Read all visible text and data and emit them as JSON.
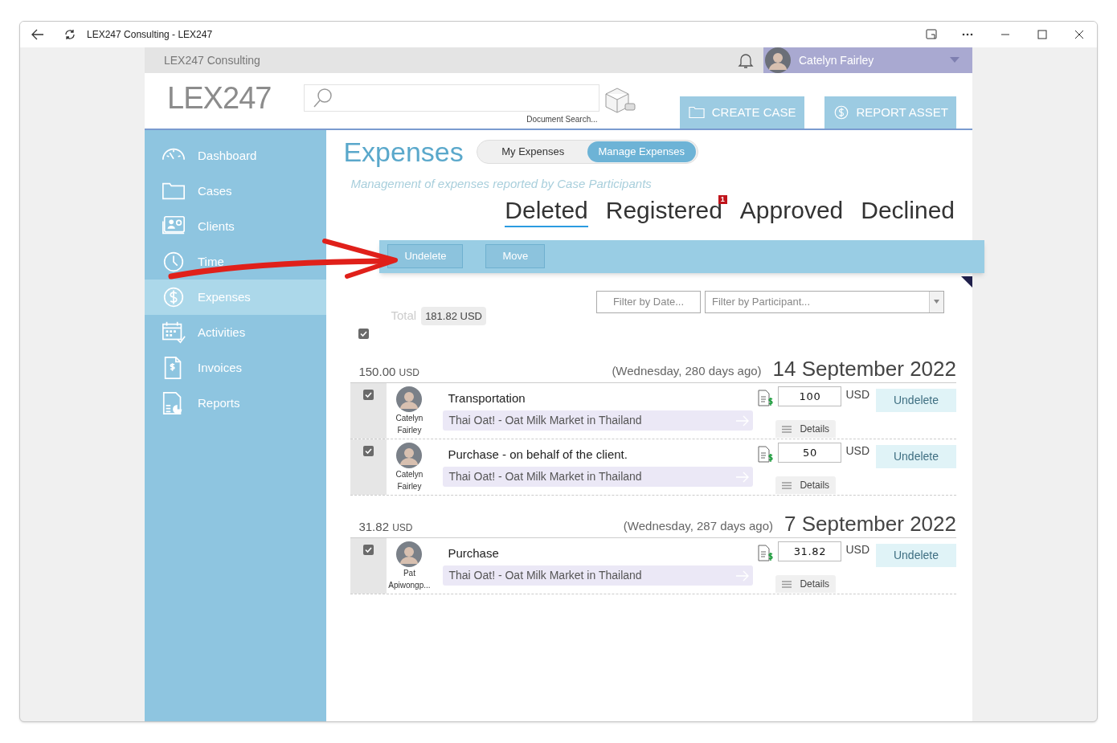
{
  "window": {
    "title": "LEX247 Consulting - LEX247"
  },
  "topbar": {
    "org_name": "LEX247 Consulting",
    "user_name": "Catelyn Fairley"
  },
  "header": {
    "logo": "LEX247",
    "search_caption": "Document Search...",
    "buttons": [
      {
        "label": "CREATE CASE",
        "kind": "folder"
      },
      {
        "label": "REPORT ASSET",
        "kind": "dollar"
      }
    ]
  },
  "sidebar": {
    "items": [
      {
        "label": "Dashboard",
        "kind": "gauge",
        "selected": false
      },
      {
        "label": "Cases",
        "kind": "folder",
        "selected": false
      },
      {
        "label": "Clients",
        "kind": "contacts",
        "selected": false
      },
      {
        "label": "Time",
        "kind": "clock",
        "selected": false
      },
      {
        "label": "Expenses",
        "kind": "dollar",
        "selected": true
      },
      {
        "label": "Activities",
        "kind": "calendar",
        "selected": false
      },
      {
        "label": "Invoices",
        "kind": "invoice",
        "selected": false
      },
      {
        "label": "Reports",
        "kind": "report",
        "selected": false
      }
    ]
  },
  "page": {
    "title": "Expenses",
    "toggle": [
      {
        "label": "My Expenses",
        "selected": false
      },
      {
        "label": "Manage Expenses",
        "selected": true
      }
    ],
    "subtitle": "Management of expenses reported by Case Participants",
    "tabs": [
      {
        "label": "Deleted",
        "selected": true
      },
      {
        "label": "Registered",
        "selected": false,
        "badge": "1"
      },
      {
        "label": "Approved",
        "selected": false
      },
      {
        "label": "Declined",
        "selected": false
      }
    ],
    "toolbar": [
      "Undelete",
      "Move"
    ],
    "filters": {
      "date_placeholder": "Filter by Date...",
      "participant_placeholder": "Filter by Participant..."
    },
    "total_label": "Total",
    "total_value": "181.82 USD",
    "select_all_checked": true,
    "groups": [
      {
        "total": "150.00",
        "unit": "USD",
        "day_info": "(Wednesday, 280 days ago)",
        "date": "14 September 2022",
        "items": [
          {
            "checked": true,
            "person": [
              "Catelyn",
              "Fairley"
            ],
            "title": "Transportation",
            "project": "Thai Oat! - Oat Milk Market in Thailand",
            "amount": "100",
            "currency": "USD",
            "action": "Undelete",
            "details": "Details"
          },
          {
            "checked": true,
            "person": [
              "Catelyn",
              "Fairley"
            ],
            "title": "Purchase - on behalf of the client.",
            "project": "Thai Oat! - Oat Milk Market in Thailand",
            "amount": "50",
            "currency": "USD",
            "action": "Undelete",
            "details": "Details"
          }
        ]
      },
      {
        "total": "31.82",
        "unit": "USD",
        "day_info": "(Wednesday, 287 days ago)",
        "date": "7 September 2022",
        "items": [
          {
            "checked": true,
            "person": [
              "Pat",
              "Apiwongp..."
            ],
            "title": "Purchase",
            "project": "Thai Oat! - Oat Milk Market in Thailand",
            "amount": "31.82",
            "currency": "USD",
            "action": "Undelete",
            "details": "Details"
          }
        ]
      }
    ]
  }
}
